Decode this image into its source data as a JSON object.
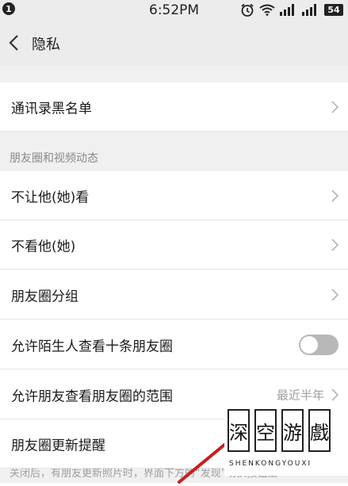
{
  "status_bar": {
    "left_badge": "1",
    "time": "6:52PM",
    "battery": "54"
  },
  "nav": {
    "title": "隐私"
  },
  "rows": {
    "blacklist": "通讯录黑名单",
    "dont_let_see": "不让他(她)看",
    "dont_see": "不看他(她)",
    "moments_groups": "朋友圈分组",
    "allow_strangers": "允许陌生人查看十条朋友圈",
    "allow_friends_range": "允许朋友查看朋友圈的范围",
    "allow_friends_range_value": "最近半年",
    "moments_update_reminder": "朋友圈更新提醒"
  },
  "section": {
    "header": "朋友圈和视频动态"
  },
  "description": "关闭后，有朋友更新照片时，界面下方的“发现”切换按钮上",
  "watermark": {
    "chars": [
      "深",
      "空",
      "游",
      "戲"
    ],
    "sub": "SHENKONGYOUXI"
  },
  "toggle": {
    "allow_strangers_on": false
  }
}
